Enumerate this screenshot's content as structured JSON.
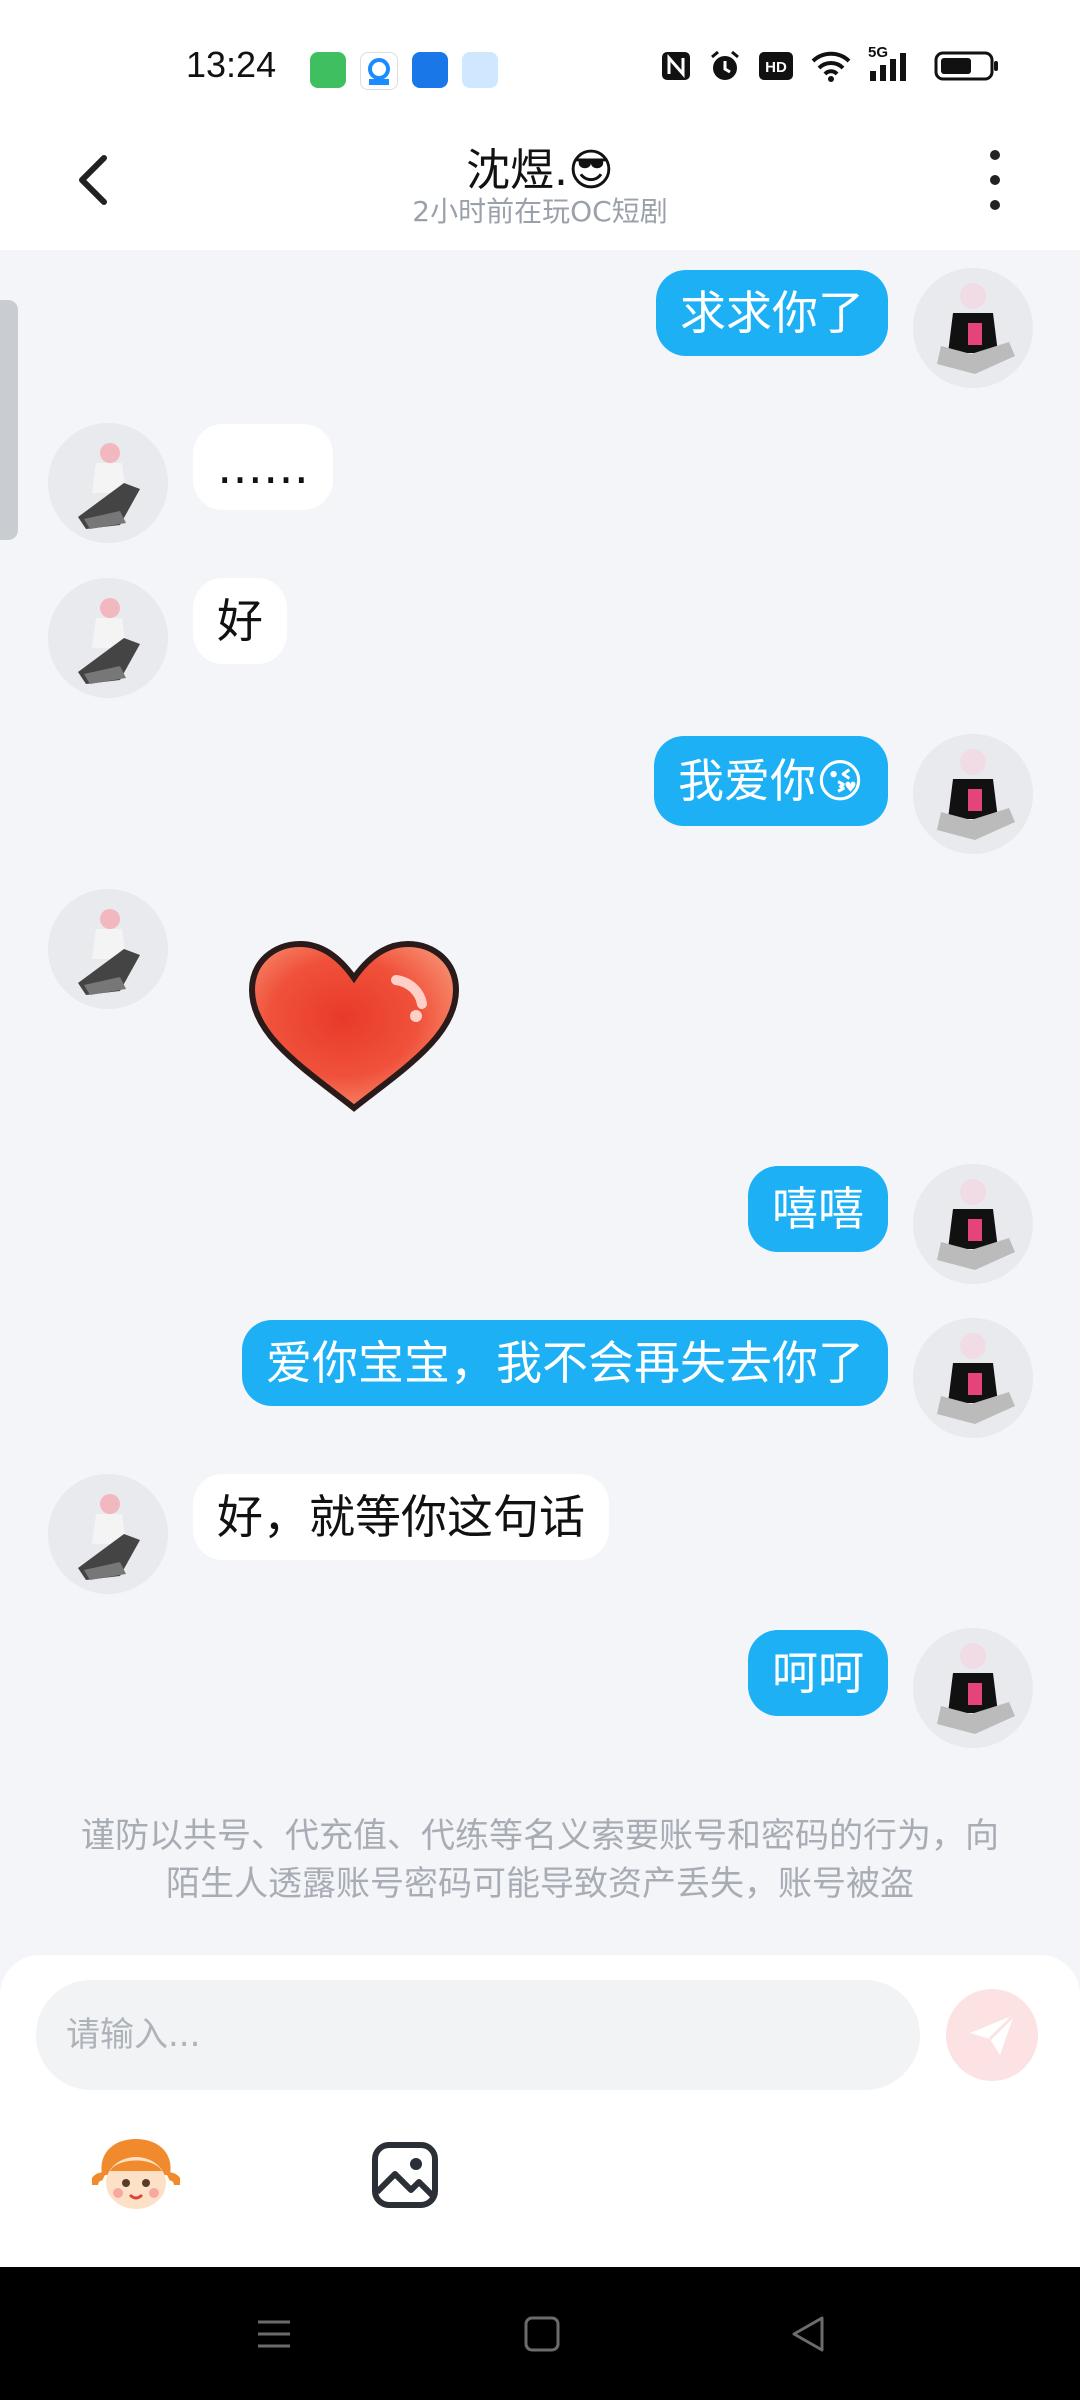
{
  "status_bar": {
    "time": "13:24",
    "app_icons": [
      "messages-app-icon",
      "weather-app-icon",
      "blue-app-icon",
      "flying-app-icon"
    ],
    "indicators": [
      "nfc-icon",
      "alarm-icon",
      "hd-icon",
      "wifi-icon",
      "5g-signal-icon",
      "battery-icon"
    ],
    "network_label": "5G",
    "hd_label": "HD"
  },
  "header": {
    "title": "沈煜.😎",
    "subtitle": "2小时前在玩OC短剧"
  },
  "messages": [
    {
      "side": "out",
      "text": "求求你了"
    },
    {
      "side": "in",
      "text": "……"
    },
    {
      "side": "in",
      "text": "好"
    },
    {
      "side": "out",
      "text": "我爱你😘"
    },
    {
      "side": "in",
      "type": "sticker",
      "sticker": "heart"
    },
    {
      "side": "out",
      "text": "嘻嘻"
    },
    {
      "side": "out",
      "text": "爱你宝宝，我不会再失去你了"
    },
    {
      "side": "in",
      "text": "好，就等你这句话"
    },
    {
      "side": "out",
      "text": "呵呵"
    }
  ],
  "notice": "谨防以共号、代充值、代练等名义索要账号和密码的行为，向陌生人透露账号密码可能导致资产丢失，账号被盗",
  "composer": {
    "placeholder": "请输入..."
  },
  "colors": {
    "outgoing_bubble": "#1eb0f5",
    "incoming_bubble": "#ffffff",
    "background": "#f3f5f8",
    "send_button": "#fde2e4"
  }
}
